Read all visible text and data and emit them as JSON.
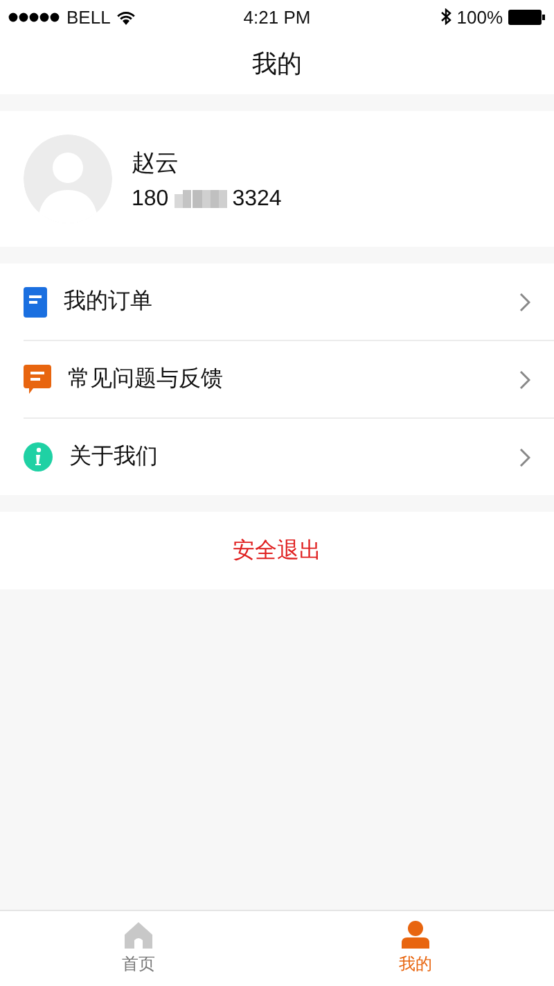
{
  "status_bar": {
    "carrier": "BELL",
    "time": "4:21 PM",
    "battery": "100%"
  },
  "nav": {
    "title": "我的"
  },
  "profile": {
    "name": "赵云",
    "phone_start": "180",
    "phone_end": "3324",
    "phone_redacted": true
  },
  "menu": [
    {
      "kind": "order",
      "label": "我的订单"
    },
    {
      "kind": "faq",
      "label": "常见问题与反馈"
    },
    {
      "kind": "about",
      "label": "关于我们"
    }
  ],
  "logout": "安全退出",
  "tabbar": [
    {
      "kind": "home",
      "label": "首页",
      "selected": false
    },
    {
      "kind": "me",
      "label": "我的",
      "selected": true
    }
  ]
}
